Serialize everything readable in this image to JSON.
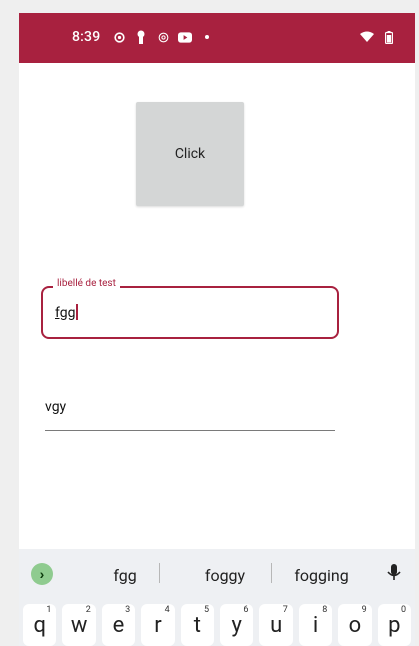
{
  "status_bar": {
    "time": "8:39",
    "left_icons": [
      "settings-gear-icon",
      "keyhole-icon",
      "settings-gear-outline-icon",
      "youtube-icon",
      "dot-icon"
    ],
    "right_icons": [
      "wifi-icon",
      "battery-icon"
    ],
    "color": "#a8213f"
  },
  "main": {
    "click_button_label": "Click",
    "outlined_field": {
      "label": "libellé de test",
      "value": "fgg"
    },
    "underline_field": {
      "value": "vgy"
    }
  },
  "keyboard": {
    "suggestions": [
      "fgg",
      "foggy",
      "fogging"
    ],
    "keys": [
      {
        "letter": "q",
        "hint": "1"
      },
      {
        "letter": "w",
        "hint": "2"
      },
      {
        "letter": "e",
        "hint": "3"
      },
      {
        "letter": "r",
        "hint": "4"
      },
      {
        "letter": "t",
        "hint": "5"
      },
      {
        "letter": "y",
        "hint": "6"
      },
      {
        "letter": "u",
        "hint": "7"
      },
      {
        "letter": "i",
        "hint": "8"
      },
      {
        "letter": "o",
        "hint": "9"
      },
      {
        "letter": "p",
        "hint": "0"
      }
    ],
    "accent": "#8fcb8f"
  }
}
